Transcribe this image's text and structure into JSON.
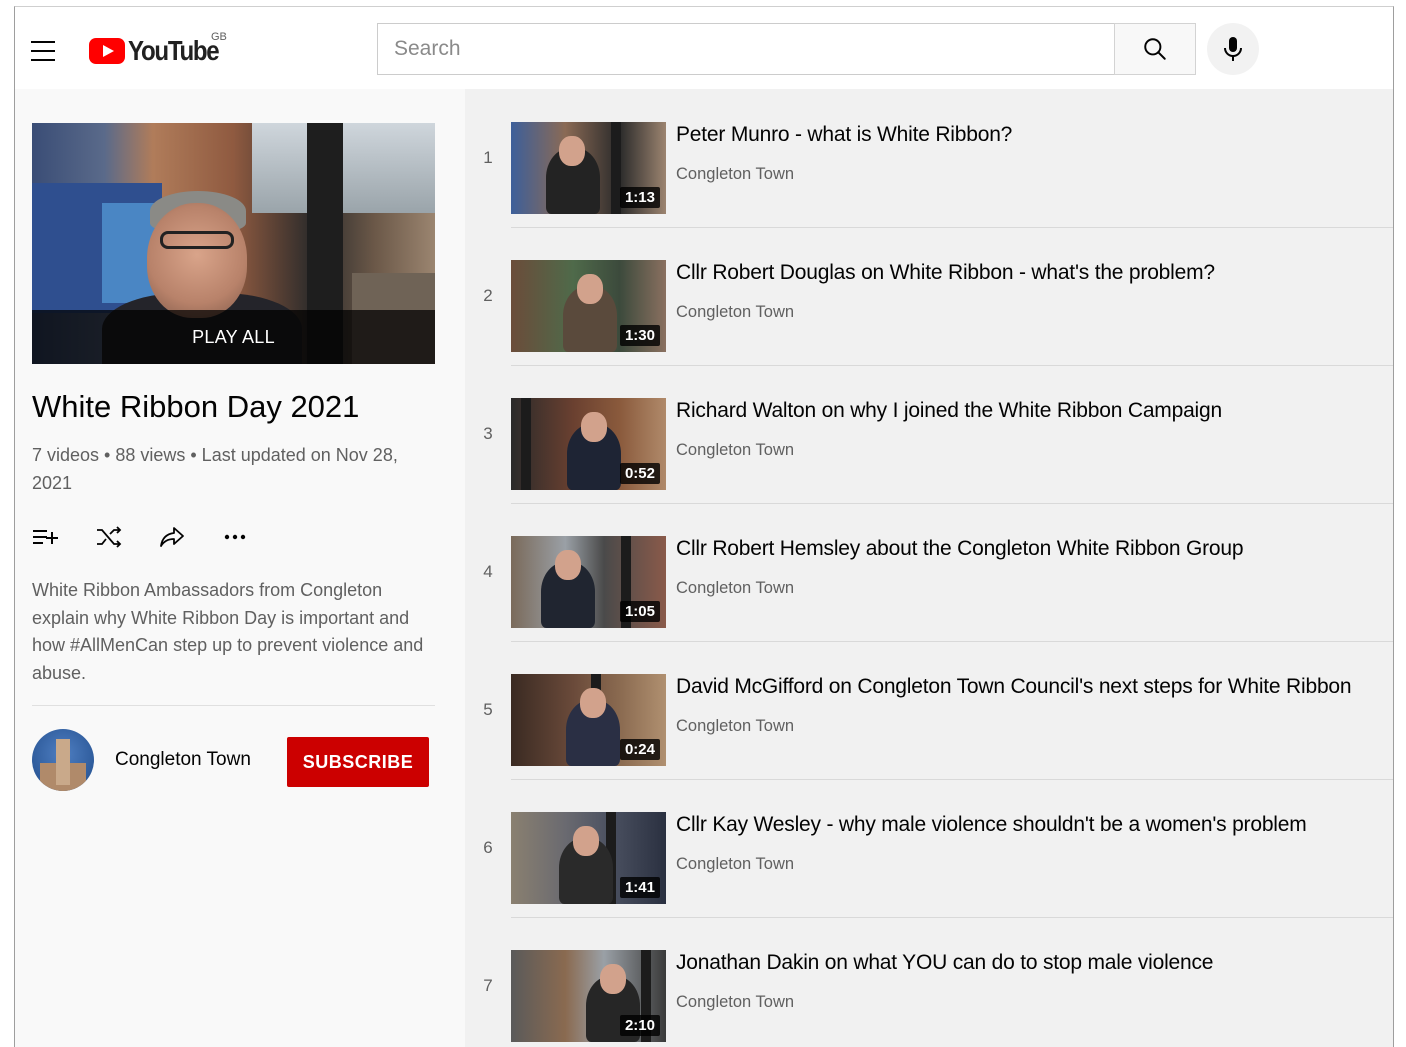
{
  "header": {
    "logo_text": "YouTube",
    "country_code": "GB",
    "search_placeholder": "Search"
  },
  "playlist": {
    "play_all_label": "PLAY ALL",
    "title": "White Ribbon Day 2021",
    "stats": "7 videos • 88 views • Last updated on Nov 28, 2021",
    "description": "White Ribbon Ambassadors from Congleton explain why White Ribbon Day is important and how #AllMenCan step up to prevent violence and abuse.",
    "channel_name": "Congleton Town",
    "subscribe_label": "SUBSCRIBE"
  },
  "colors": {
    "brand_red": "#ff0000",
    "subscribe_red": "#cc0000",
    "list_bg": "#f1f1f1",
    "panel_bg": "#f9f9f9"
  },
  "videos": [
    {
      "index": "1",
      "title": "Peter Munro - what is White Ribbon?",
      "channel": "Congleton Town",
      "duration": "1:13"
    },
    {
      "index": "2",
      "title": "Cllr Robert Douglas on White Ribbon - what's the problem?",
      "channel": "Congleton Town",
      "duration": "1:30"
    },
    {
      "index": "3",
      "title": "Richard Walton on why I joined the White Ribbon Campaign",
      "channel": "Congleton Town",
      "duration": "0:52"
    },
    {
      "index": "4",
      "title": "Cllr Robert Hemsley about the Congleton White Ribbon Group",
      "channel": "Congleton Town",
      "duration": "1:05"
    },
    {
      "index": "5",
      "title": "David McGifford on Congleton Town Council's next steps for White Ribbon",
      "channel": "Congleton Town",
      "duration": "0:24"
    },
    {
      "index": "6",
      "title": "Cllr Kay Wesley - why male violence shouldn't be a women's problem",
      "channel": "Congleton Town",
      "duration": "1:41"
    },
    {
      "index": "7",
      "title": "Jonathan Dakin on what YOU can do to stop male violence",
      "channel": "Congleton Town",
      "duration": "2:10"
    }
  ]
}
